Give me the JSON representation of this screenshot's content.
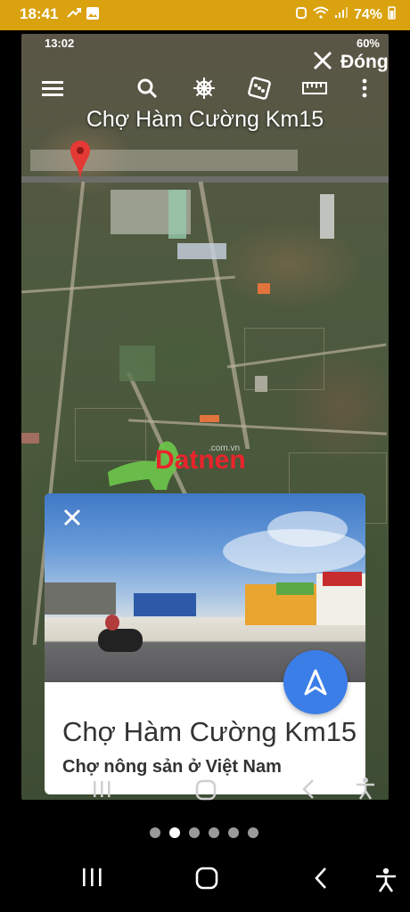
{
  "outer_status": {
    "time": "18:41",
    "battery": "74%",
    "accent_color": "#d9a20e"
  },
  "inner_status": {
    "time": "13:02",
    "battery": "60%"
  },
  "header": {
    "close_label": "Đóng",
    "place_title": "Chợ Hàm Cường Km15"
  },
  "toolbar": {
    "icons": [
      "menu-icon",
      "search-icon",
      "ship-wheel-icon",
      "dice-icon",
      "ruler-icon",
      "more-vert-icon"
    ]
  },
  "watermark": {
    "text": "Datnen",
    "small_text": ".com.vn"
  },
  "card": {
    "title": "Chợ Hàm Cường Km15",
    "subtitle": "Chợ nông sản ở Việt Nam",
    "fab_color": "#3b7ee8"
  },
  "pager": {
    "count": 6,
    "active_index": 1
  }
}
